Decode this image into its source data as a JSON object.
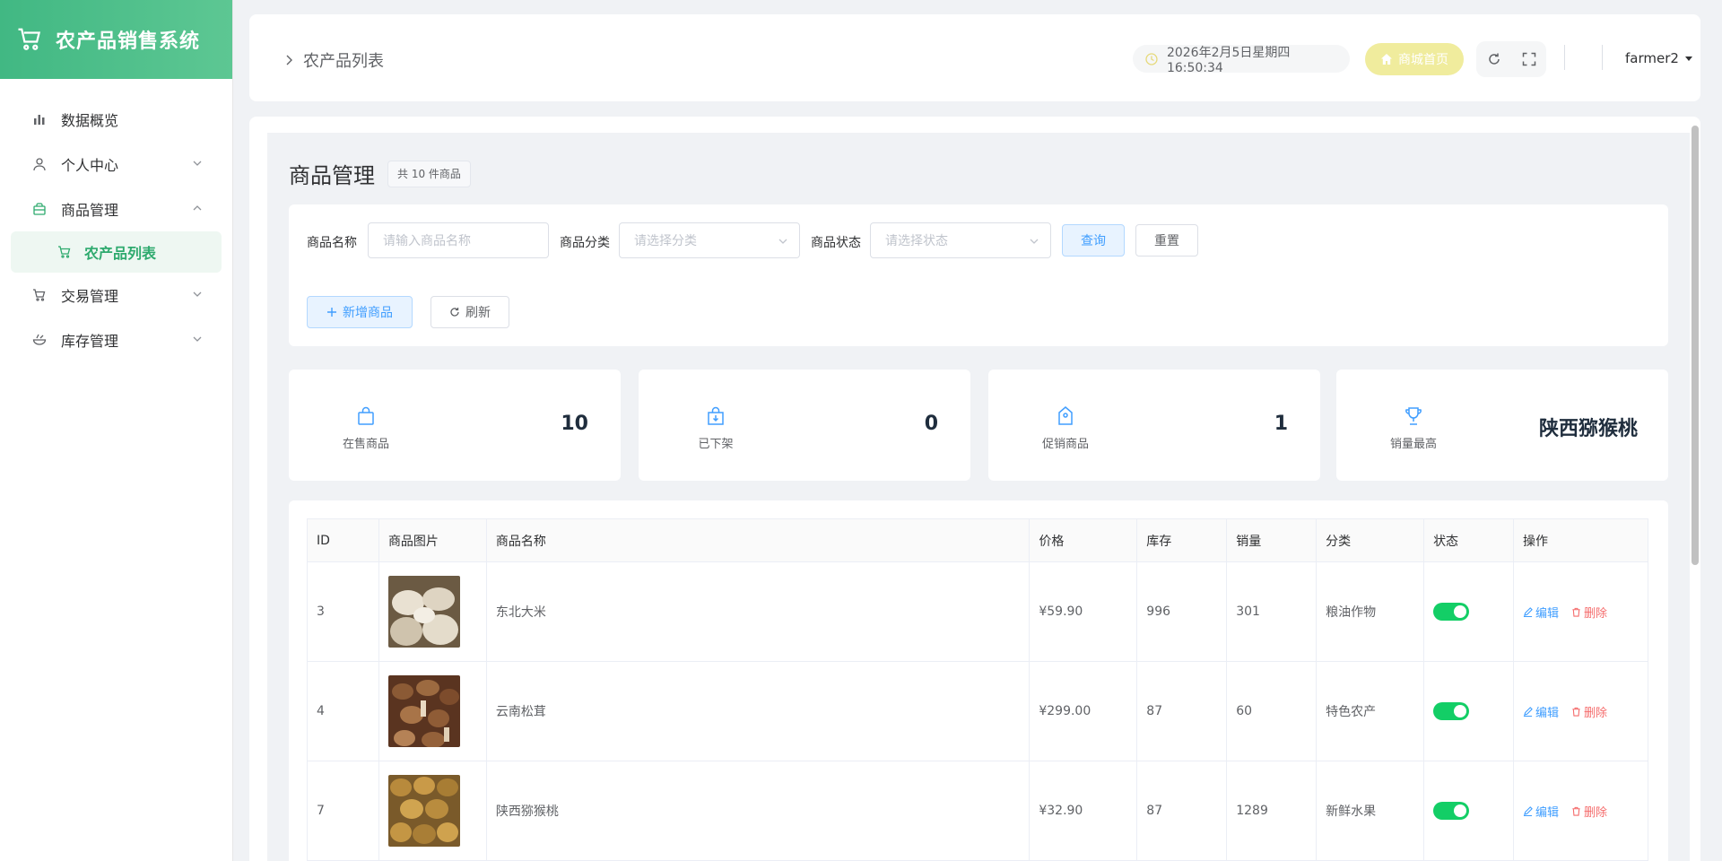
{
  "app": {
    "title": "农产品销售系统"
  },
  "sidebar": {
    "items": [
      {
        "label": "数据概览",
        "icon": "bar-chart-icon"
      },
      {
        "label": "个人中心",
        "icon": "user-icon"
      },
      {
        "label": "商品管理",
        "icon": "bag-icon"
      },
      {
        "label": "交易管理",
        "icon": "cart-icon"
      },
      {
        "label": "库存管理",
        "icon": "bowl-icon"
      }
    ],
    "active_sub": {
      "label": "农产品列表",
      "icon": "cart-icon"
    }
  },
  "header": {
    "breadcrumb": "农产品列表",
    "datetime": "2026年2月5日星期四 16:50:34",
    "shop_home": "商城首页",
    "username": "farmer2"
  },
  "page": {
    "title": "商品管理",
    "count_badge": "共 10 件商品"
  },
  "filter": {
    "name_label": "商品名称",
    "name_placeholder": "请输入商品名称",
    "category_label": "商品分类",
    "category_placeholder": "请选择分类",
    "status_label": "商品状态",
    "status_placeholder": "请选择状态",
    "query": "查询",
    "reset": "重置",
    "add": "新增商品",
    "refresh": "刷新"
  },
  "stats": [
    {
      "label": "在售商品",
      "value": "10",
      "icon": "shopping-bag-icon"
    },
    {
      "label": "已下架",
      "value": "0",
      "icon": "bag-down-icon"
    },
    {
      "label": "促销商品",
      "value": "1",
      "icon": "price-tag-icon"
    },
    {
      "label": "销量最高",
      "value": "陕西猕猴桃",
      "icon": "trophy-icon"
    }
  ],
  "table": {
    "headers": [
      "ID",
      "商品图片",
      "商品名称",
      "价格",
      "库存",
      "销量",
      "分类",
      "状态",
      "操作"
    ],
    "edit": "编辑",
    "delete": "删除",
    "rows": [
      {
        "id": "3",
        "name": "东北大米",
        "price": "¥59.90",
        "stock": "996",
        "sales": "301",
        "category": "粮油作物",
        "enabled": true
      },
      {
        "id": "4",
        "name": "云南松茸",
        "price": "¥299.00",
        "stock": "87",
        "sales": "60",
        "category": "特色农产",
        "enabled": true
      },
      {
        "id": "7",
        "name": "陕西猕猴桃",
        "price": "¥32.90",
        "stock": "87",
        "sales": "1289",
        "category": "新鲜水果",
        "enabled": true
      }
    ]
  },
  "colors": {
    "brand": "#41b883",
    "primary": "#409eff",
    "danger": "#f56c6c",
    "switch_on": "#13ce66"
  }
}
